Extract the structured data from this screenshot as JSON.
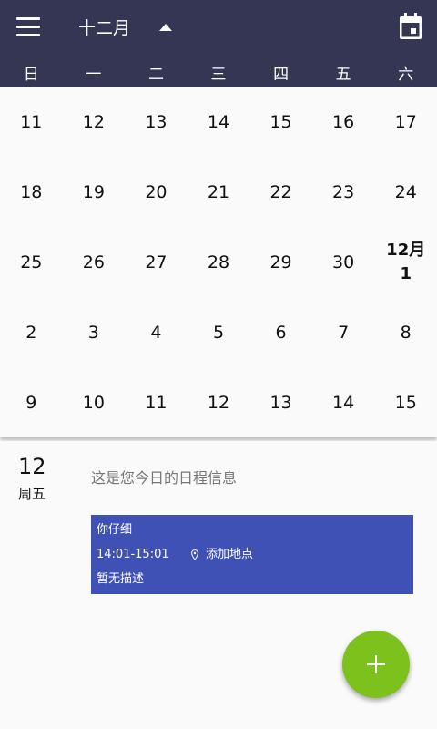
{
  "header": {
    "menu_icon": "menu-icon",
    "month_title": "十二月",
    "toggle_icon": "caret-up-icon",
    "calendar_icon": "calendar-icon",
    "weekdays": [
      "日",
      "一",
      "二",
      "三",
      "四",
      "五",
      "六"
    ]
  },
  "calendar": {
    "weeks": [
      [
        "11",
        "12",
        "13",
        "14",
        "15",
        "16",
        "17"
      ],
      [
        "18",
        "19",
        "20",
        "21",
        "22",
        "23",
        "24"
      ],
      [
        "25",
        "26",
        "27",
        "28",
        "29",
        "30",
        "12月\n1"
      ],
      [
        "2",
        "3",
        "4",
        "5",
        "6",
        "7",
        "8"
      ],
      [
        "9",
        "10",
        "11",
        "12",
        "13",
        "14",
        "15"
      ]
    ],
    "highlight_month_label": "12月",
    "highlight_day": "1"
  },
  "detail": {
    "date": "12",
    "weekday": "周五",
    "schedule_info": "这是您今日的日程信息",
    "event": {
      "title": "你仔细",
      "time": "14:01-15:01",
      "location": "添加地点",
      "description": "暂无描述",
      "color": "#3f51b5"
    }
  },
  "fab": {
    "icon": "plus-icon",
    "color": "#7dc11d"
  },
  "colors": {
    "appbar": "#343654",
    "background": "#fafafa"
  }
}
